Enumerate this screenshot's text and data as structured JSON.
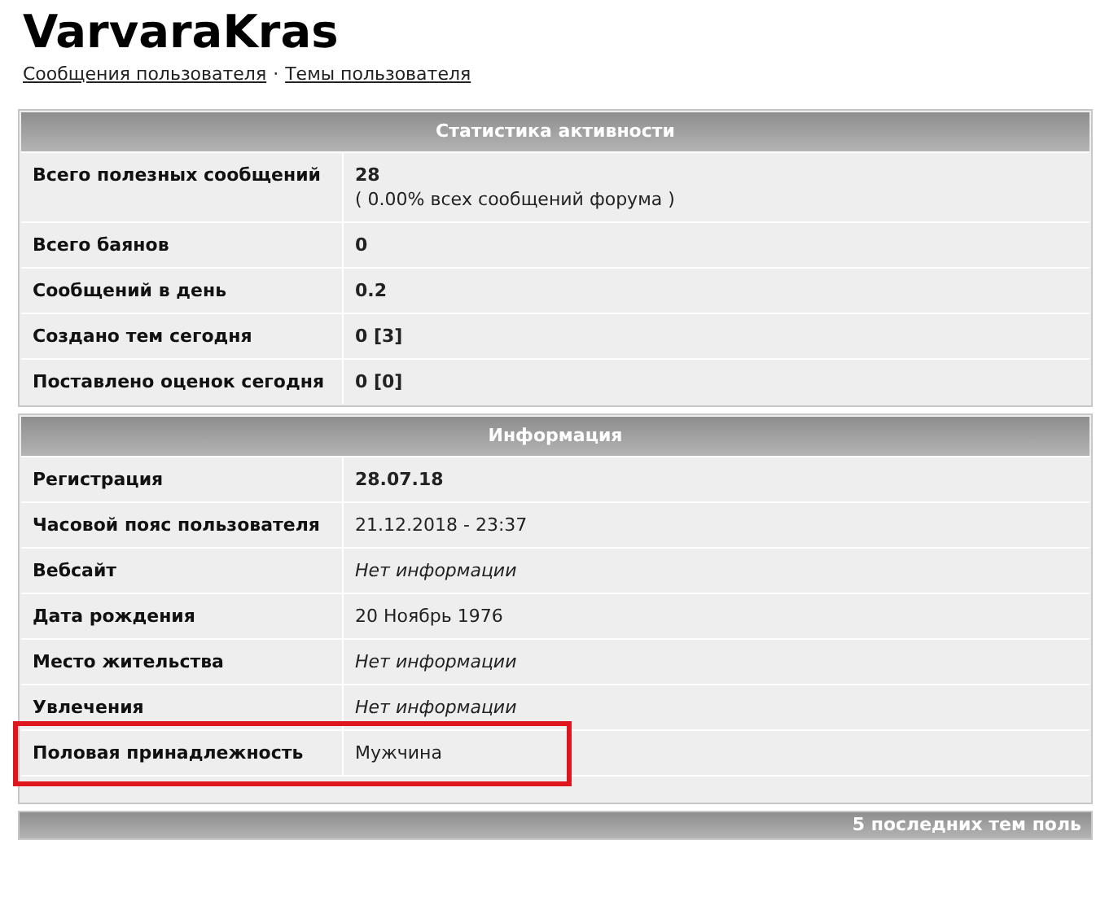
{
  "title": "VarvaraKras",
  "links": [
    "Сообщения пользователя",
    "Темы пользователя"
  ],
  "link_separator": "·",
  "sections": [
    {
      "title": "Статистика активности",
      "rows": [
        {
          "label": "Всего полезных сообщений",
          "value": "28",
          "note": "( 0.00% всех сообщений форума )",
          "kind": "bold",
          "highlighted": false
        },
        {
          "label": "Всего баянов",
          "value": "0",
          "kind": "bold",
          "highlighted": false
        },
        {
          "label": "Сообщений в день",
          "value": "0.2",
          "kind": "bold",
          "highlighted": false
        },
        {
          "label": "Создано тем сегодня",
          "value": "0 [3]",
          "kind": "bold",
          "highlighted": false
        },
        {
          "label": "Поставлено оценок сегодня",
          "value": "0 [0]",
          "kind": "bold",
          "highlighted": false
        }
      ]
    },
    {
      "title": "Информация",
      "rows": [
        {
          "label": "Регистрация",
          "value": "28.07.18",
          "kind": "bold",
          "highlighted": false
        },
        {
          "label": "Часовой пояс пользователя",
          "value": "21.12.2018 - 23:37",
          "kind": "plain",
          "highlighted": false
        },
        {
          "label": "Вебсайт",
          "value": "Нет информации",
          "kind": "italic",
          "highlighted": false
        },
        {
          "label": "Дата рождения",
          "value": "20 Ноябрь 1976",
          "kind": "plain",
          "highlighted": false
        },
        {
          "label": "Место жительства",
          "value": "Нет информации",
          "kind": "italic",
          "highlighted": false
        },
        {
          "label": "Увлечения",
          "value": "Нет информации",
          "kind": "italic",
          "highlighted": false
        },
        {
          "label": "Половая принадлежность",
          "value": "Мужчина",
          "kind": "plain",
          "highlighted": true
        }
      ]
    }
  ],
  "next_section": {
    "title": "5 последних тем поль"
  }
}
